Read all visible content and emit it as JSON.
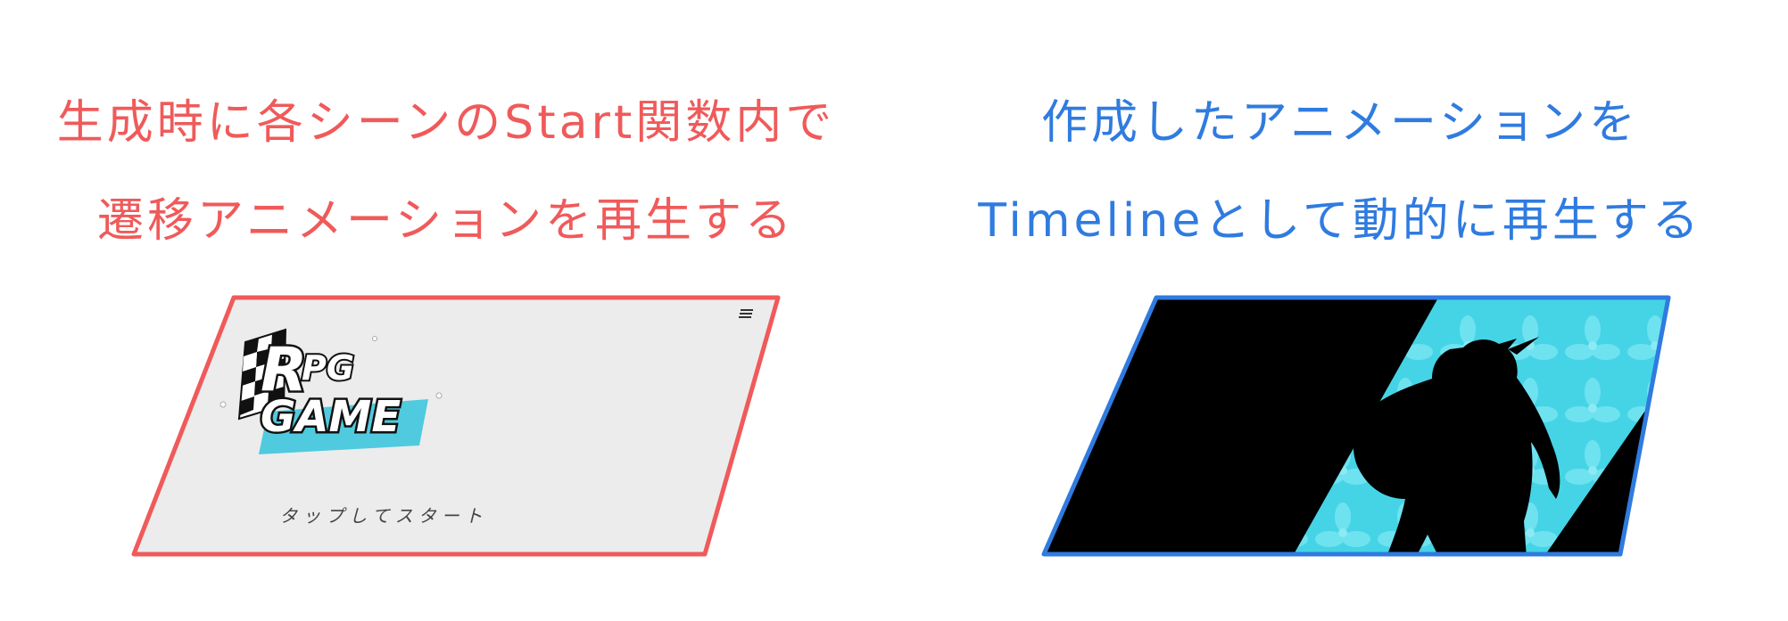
{
  "left": {
    "caption_line1": "生成時に各シーンのStart関数内で",
    "caption_line2": "遷移アニメーションを再生する",
    "color": "#f05a5a",
    "screen": {
      "logo_line1": "RPG",
      "logo_line2": "GAME",
      "menu_icon": "hamburger-menu-icon",
      "tap_text": "タップしてスタート",
      "background": "#ececec"
    }
  },
  "right": {
    "caption_line1": "作成したアニメーションを",
    "caption_line2": "Timelineとして動的に再生する",
    "color": "#2f7be0",
    "screen": {
      "background": "#000000",
      "stripe_color": "#45d4e6",
      "figure": "character-silhouette"
    }
  }
}
